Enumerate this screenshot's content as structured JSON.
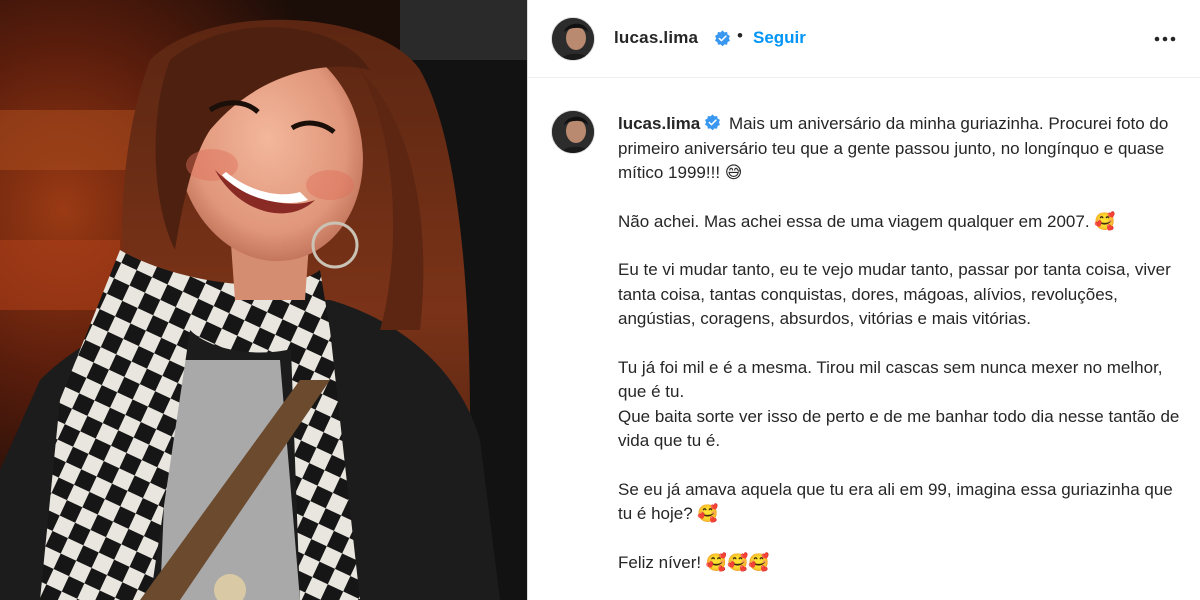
{
  "post": {
    "author": {
      "username": "lucas.lima",
      "verified": true,
      "follow_label": "Seguir",
      "separator": "•"
    },
    "more_icon": "more-horizontal-icon",
    "caption": {
      "intro": "Mais um aniversário da minha guriazinha. Procurei foto do primeiro aniversário teu que a gente passou junto, no longínquo e quase mítico 1999!!! 😅",
      "paragraphs": [
        "Não achei. Mas achei essa de uma viagem qualquer em 2007. 🥰",
        "Eu te vi mudar tanto, eu te vejo mudar tanto, passar por tanta coisa, viver tanta coisa, tantas conquistas, dores, mágoas, alívios, revoluções, angústias, coragens, absurdos, vitórias e mais vitórias.",
        "Tu já foi mil e é a mesma. Tirou mil cascas sem nunca mexer no melhor, que é tu.",
        "Que baita sorte ver isso de perto e de me banhar todo dia nesse tantão de vida que tu é.",
        "Se eu já amava aquela que tu era ali em 99, imagina essa guriazinha que tu é hoje? 🥰",
        "Feliz níver! 🥰🥰🥰"
      ]
    },
    "colors": {
      "link_blue": "#0095f6",
      "verified_blue": "#3897f0",
      "text": "#262626",
      "border": "#dbdbdb"
    }
  }
}
